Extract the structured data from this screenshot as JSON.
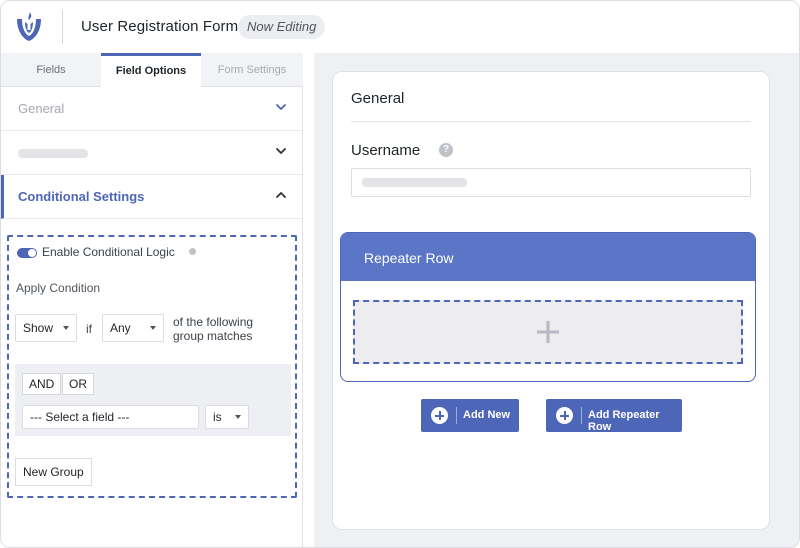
{
  "header": {
    "form_title": "User Registration Form",
    "status_badge": "Now Editing",
    "logo_icon": "tulip-logo-icon"
  },
  "tabs": [
    {
      "label": "Fields",
      "active": false
    },
    {
      "label": "Field Options",
      "active": true
    },
    {
      "label": "Form Settings",
      "active": false
    }
  ],
  "accordion": {
    "general_label": "General",
    "conditional_label": "Conditional Settings"
  },
  "conditional": {
    "enable_label": "Enable Conditional Logic",
    "enabled": true,
    "apply_label": "Apply Condition",
    "action_value": "Show",
    "if_label": "if",
    "match_value": "Any",
    "following_label": "of the following group matches",
    "and_label": "AND",
    "or_label": "OR",
    "field_value": "--- Select a field ---",
    "operator_value": "is",
    "new_group_label": "New Group"
  },
  "canvas": {
    "section_title": "General",
    "username_label": "Username",
    "help_glyph": "?",
    "repeater_title": "Repeater Row",
    "add_new_label": "Add New",
    "add_repeater_row_label": "Add Repeater Row"
  },
  "colors": {
    "accent": "#4e66b7",
    "repeater_header": "#5b76c6",
    "canvas_bg": "#eef0f3"
  }
}
